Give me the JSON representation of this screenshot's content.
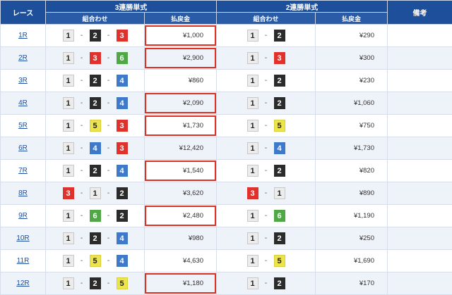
{
  "header": {
    "race": "レース",
    "trifecta": "3連勝単式",
    "exacta": "2連勝単式",
    "note": "備考",
    "combo": "組合わせ",
    "payout": "払戻金"
  },
  "separator": "-",
  "highlight_color": "#e03020",
  "boat_colors": {
    "1": "#ececec",
    "2": "#2b2b2b",
    "3": "#e0322c",
    "4": "#3f79c9",
    "5": "#ece44c",
    "6": "#4fa845"
  },
  "rows": [
    {
      "race": "1R",
      "tri": [
        "1",
        "2",
        "3"
      ],
      "tri_pay": "¥1,000",
      "tri_hl": true,
      "ex": [
        "1",
        "2"
      ],
      "ex_pay": "¥290"
    },
    {
      "race": "2R",
      "tri": [
        "1",
        "3",
        "6"
      ],
      "tri_pay": "¥2,900",
      "tri_hl": true,
      "ex": [
        "1",
        "3"
      ],
      "ex_pay": "¥300"
    },
    {
      "race": "3R",
      "tri": [
        "1",
        "2",
        "4"
      ],
      "tri_pay": "¥860",
      "tri_hl": false,
      "ex": [
        "1",
        "2"
      ],
      "ex_pay": "¥230"
    },
    {
      "race": "4R",
      "tri": [
        "1",
        "2",
        "4"
      ],
      "tri_pay": "¥2,090",
      "tri_hl": true,
      "ex": [
        "1",
        "2"
      ],
      "ex_pay": "¥1,060"
    },
    {
      "race": "5R",
      "tri": [
        "1",
        "5",
        "3"
      ],
      "tri_pay": "¥1,730",
      "tri_hl": true,
      "ex": [
        "1",
        "5"
      ],
      "ex_pay": "¥750"
    },
    {
      "race": "6R",
      "tri": [
        "1",
        "4",
        "3"
      ],
      "tri_pay": "¥12,420",
      "tri_hl": false,
      "ex": [
        "1",
        "4"
      ],
      "ex_pay": "¥1,730"
    },
    {
      "race": "7R",
      "tri": [
        "1",
        "2",
        "4"
      ],
      "tri_pay": "¥1,540",
      "tri_hl": true,
      "ex": [
        "1",
        "2"
      ],
      "ex_pay": "¥820"
    },
    {
      "race": "8R",
      "tri": [
        "3",
        "1",
        "2"
      ],
      "tri_pay": "¥3,620",
      "tri_hl": false,
      "ex": [
        "3",
        "1"
      ],
      "ex_pay": "¥890"
    },
    {
      "race": "9R",
      "tri": [
        "1",
        "6",
        "2"
      ],
      "tri_pay": "¥2,480",
      "tri_hl": true,
      "ex": [
        "1",
        "6"
      ],
      "ex_pay": "¥1,190"
    },
    {
      "race": "10R",
      "tri": [
        "1",
        "2",
        "4"
      ],
      "tri_pay": "¥980",
      "tri_hl": false,
      "ex": [
        "1",
        "2"
      ],
      "ex_pay": "¥250"
    },
    {
      "race": "11R",
      "tri": [
        "1",
        "5",
        "4"
      ],
      "tri_pay": "¥4,630",
      "tri_hl": false,
      "ex": [
        "1",
        "5"
      ],
      "ex_pay": "¥1,690"
    },
    {
      "race": "12R",
      "tri": [
        "1",
        "2",
        "5"
      ],
      "tri_pay": "¥1,180",
      "tri_hl": true,
      "ex": [
        "1",
        "2"
      ],
      "ex_pay": "¥170"
    }
  ]
}
